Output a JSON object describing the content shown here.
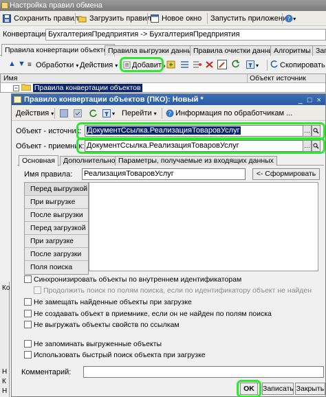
{
  "window": {
    "title": "Настройка правил обмена"
  },
  "toolbar": {
    "save_rules": "Сохранить правила",
    "load_rules": "Загрузить правила",
    "new_window": "Новое окно",
    "run_app": "Запустить приложение"
  },
  "conversion": {
    "label": "Конвертация:",
    "value": "БухгалтерияПредприятия -> БухгалтерияПредприятия"
  },
  "tabs": [
    "Правила конвертации объектов",
    "Правила выгрузки данных",
    "Правила очистки данных",
    "Алгоритмы",
    "Запр"
  ],
  "rules_toolbar": {
    "handlers": "Обработки",
    "actions": "Действия",
    "add": "Добавить",
    "copy": "Скопировать"
  },
  "grid": {
    "columns": [
      "Имя",
      "Объект источник"
    ],
    "rows": [
      {
        "name": "Правила конвертации объектов"
      }
    ]
  },
  "side_letters": [
    "Ко",
    "Н",
    "К",
    "Н"
  ],
  "dialog": {
    "title": "Правило конвертации объектов (ПКО): Новый *",
    "toolbar": {
      "actions": "Действия",
      "goto": "Перейти",
      "handlers_info": "Информация по обработчикам ..."
    },
    "source": {
      "label": "Объект - источник:",
      "value": "ДокументСсылка.РеализацияТоваровУслуг"
    },
    "target": {
      "label": "Объект - приемник:",
      "value": "ДокументСсылка.РеализацияТоваровУслуг"
    },
    "tabs": [
      "Основная",
      "Дополнительно",
      "Параметры, получаемые из входящих данных"
    ],
    "rule_name": {
      "label": "Имя правила:",
      "value": "РеализацияТоваровУслуг",
      "form_button": "<- Сформировать"
    },
    "events": [
      "Перед выгрузкой",
      "При выгрузке",
      "После выгрузки",
      "Перед загрузкой",
      "При загрузке",
      "После загрузки",
      "Поля поиска"
    ],
    "checkboxes": [
      "Синхронизировать объекты по внутреннем идентификаторам",
      "Продолжить поиск по полям поиска, если по идентификатору объект не найден",
      "Не замещать найденные объекты при загрузке",
      "Не создавать объект в приемнике, если он не найден по полям поиска",
      "Не выгружать объекты свойств по ссылкам",
      "Не запоминать выгруженные объекты",
      "Использовать быстрый поиск объекта при загрузке"
    ],
    "comment_label": "Комментарий:",
    "buttons": {
      "ok": "OK",
      "save": "Записать",
      "close": "Закрыть"
    }
  },
  "colors": {
    "highlight": "#2ee82e",
    "dialog_title": "#2a5aa6",
    "selection": "#0a246a"
  }
}
